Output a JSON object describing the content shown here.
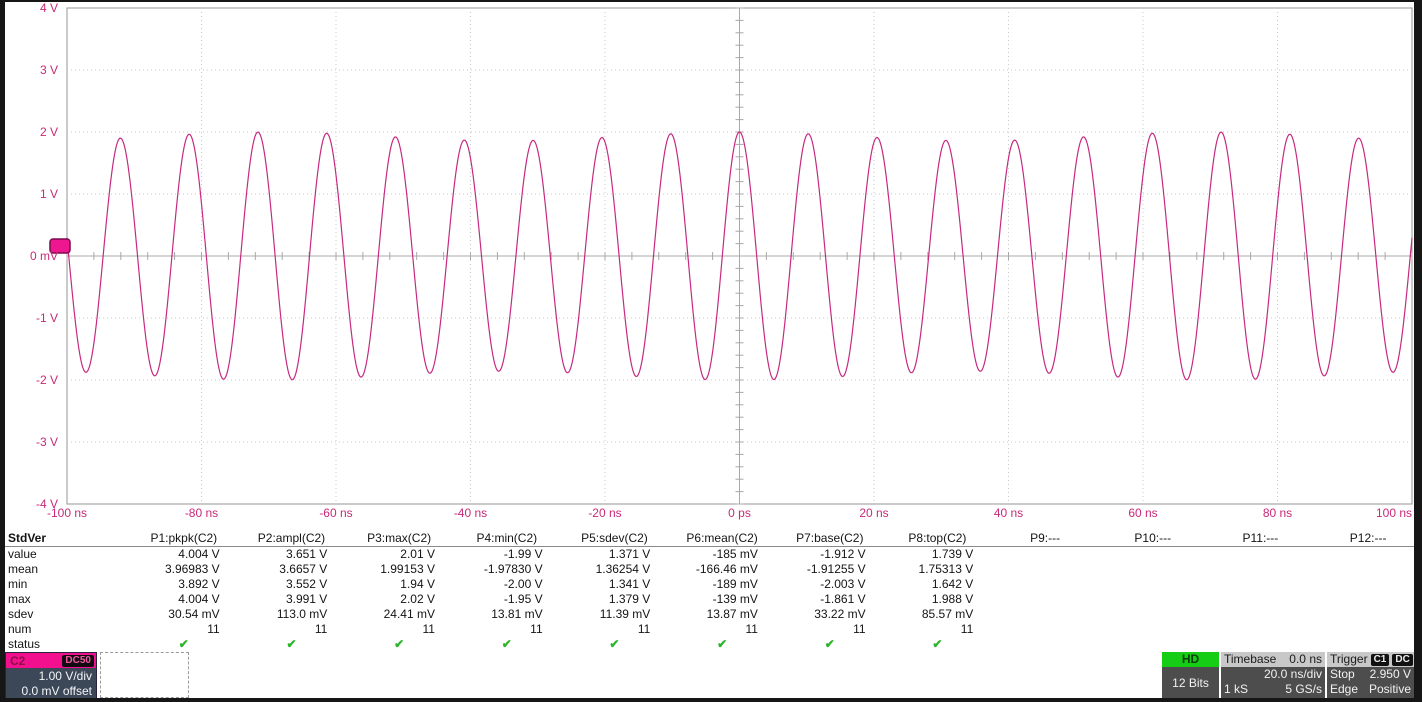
{
  "plot": {
    "y_axis": {
      "ticks": [
        {
          "label": "4 V",
          "v": 4
        },
        {
          "label": "3 V",
          "v": 3
        },
        {
          "label": "2 V",
          "v": 2
        },
        {
          "label": "1 V",
          "v": 1
        },
        {
          "label": "0 mV",
          "v": 0
        },
        {
          "label": "-1 V",
          "v": -1
        },
        {
          "label": "-2 V",
          "v": -2
        },
        {
          "label": "-3 V",
          "v": -3
        },
        {
          "label": "-4 V",
          "v": -4
        }
      ],
      "range_v": [
        -4,
        4
      ],
      "volts_per_div": 1.0
    },
    "x_axis": {
      "ticks": [
        {
          "label": "-100 ns",
          "t": -100
        },
        {
          "label": "-80 ns",
          "t": -80
        },
        {
          "label": "-60 ns",
          "t": -60
        },
        {
          "label": "-40 ns",
          "t": -40
        },
        {
          "label": "-20 ns",
          "t": -20
        },
        {
          "label": "0 ps",
          "t": 0
        },
        {
          "label": "20 ns",
          "t": 20
        },
        {
          "label": "40 ns",
          "t": 40
        },
        {
          "label": "60 ns",
          "t": 60
        },
        {
          "label": "80 ns",
          "t": 80
        },
        {
          "label": "100 ns",
          "t": 100
        }
      ],
      "range_ns": [
        -100,
        100
      ],
      "ns_per_div": 20
    },
    "waveform": {
      "type": "sine",
      "channel": "C2",
      "amplitude_v": 1.93,
      "amplitude_mod_v": 0.07,
      "amplitude_mod_period_ns": 70,
      "period_ns": 10.23,
      "peak_at_ns": 0,
      "offset_v": 0
    }
  },
  "measurements": {
    "title": "StdVer",
    "row_labels": [
      "value",
      "mean",
      "min",
      "max",
      "sdev",
      "num",
      "status"
    ],
    "check_glyph": "✔",
    "columns": [
      {
        "header": "P1:pkpk(C2)",
        "value": "4.004 V",
        "mean": "3.96983 V",
        "min": "3.892 V",
        "max": "4.004 V",
        "sdev": "30.54 mV",
        "num": "11",
        "status": "ok"
      },
      {
        "header": "P2:ampl(C2)",
        "value": "3.651 V",
        "mean": "3.6657 V",
        "min": "3.552 V",
        "max": "3.991 V",
        "sdev": "113.0 mV",
        "num": "11",
        "status": "ok"
      },
      {
        "header": "P3:max(C2)",
        "value": "2.01 V",
        "mean": "1.99153 V",
        "min": "1.94 V",
        "max": "2.02 V",
        "sdev": "24.41 mV",
        "num": "11",
        "status": "ok"
      },
      {
        "header": "P4:min(C2)",
        "value": "-1.99 V",
        "mean": "-1.97830 V",
        "min": "-2.00 V",
        "max": "-1.95 V",
        "sdev": "13.81 mV",
        "num": "11",
        "status": "ok"
      },
      {
        "header": "P5:sdev(C2)",
        "value": "1.371 V",
        "mean": "1.36254 V",
        "min": "1.341 V",
        "max": "1.379 V",
        "sdev": "11.39 mV",
        "num": "11",
        "status": "ok"
      },
      {
        "header": "P6:mean(C2)",
        "value": "-185 mV",
        "mean": "-166.46 mV",
        "min": "-189 mV",
        "max": "-139 mV",
        "sdev": "13.87 mV",
        "num": "11",
        "status": "ok"
      },
      {
        "header": "P7:base(C2)",
        "value": "-1.912 V",
        "mean": "-1.91255 V",
        "min": "-2.003 V",
        "max": "-1.861 V",
        "sdev": "33.22 mV",
        "num": "11",
        "status": "ok"
      },
      {
        "header": "P8:top(C2)",
        "value": "1.739 V",
        "mean": "1.75313 V",
        "min": "1.642 V",
        "max": "1.988 V",
        "sdev": "85.57 mV",
        "num": "11",
        "status": "ok"
      },
      {
        "header": "P9:---"
      },
      {
        "header": "P10:---"
      },
      {
        "header": "P11:---"
      },
      {
        "header": "P12:---"
      }
    ]
  },
  "channel_box": {
    "name": "C2",
    "coupling": "DC50",
    "scale": "1.00 V/div",
    "offset": "0.0 mV offset"
  },
  "acquisition": {
    "hd_label": "HD",
    "bits": "12 Bits"
  },
  "timebase": {
    "label": "Timebase",
    "position": "0.0 ns",
    "scale": "20.0 ns/div",
    "samples": "1 kS",
    "rate": "5 GS/s"
  },
  "trigger": {
    "label": "Trigger",
    "source": "C1",
    "coupling": "DC",
    "mode": "Stop",
    "level": "2.950 V",
    "type": "Edge",
    "slope": "Positive"
  },
  "colors": {
    "trace": "#c62a80",
    "axis_label": "#c82a78",
    "marker_fill": "#ee1790",
    "marker_border": "#7c0c4e",
    "grid_dot": "#c9c9c9",
    "grid_center": "#a8a8a8",
    "plot_border": "#969696",
    "status_ok": "#2ab52a",
    "channel_header": "#f2108f",
    "hd_green": "#16cd16"
  }
}
